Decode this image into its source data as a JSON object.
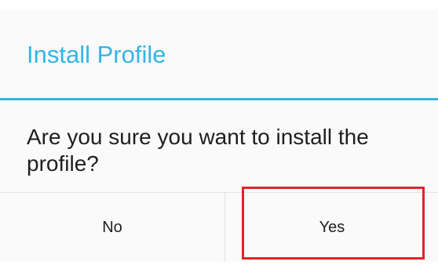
{
  "dialog": {
    "title": "Install Profile",
    "message": "Are you sure you want to install the profile?",
    "buttons": {
      "no_label": "No",
      "yes_label": "Yes"
    }
  },
  "colors": {
    "accent": "#33b5e5",
    "highlight": "#e0242d",
    "text": "#1f1f1f",
    "background": "#fafafa"
  }
}
